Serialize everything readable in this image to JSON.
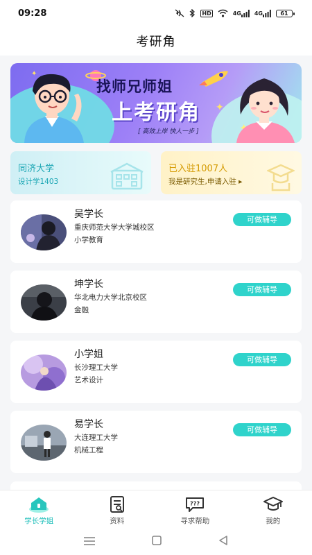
{
  "status_bar": {
    "time": "09:28",
    "net1": "4G",
    "net2": "4G",
    "hd": "HD",
    "battery": "61"
  },
  "header": {
    "title": "考研角"
  },
  "banner": {
    "title_line1": "找师兄师姐",
    "title_line2": "上考研角",
    "slogan": "[ 高效上岸 快人一步 ]"
  },
  "info_cards": {
    "left": {
      "title": "同济大学",
      "subtitle": "设计学1403"
    },
    "right": {
      "title": "已入驻1007人",
      "subtitle": "我是研究生,申请入驻 ▸"
    }
  },
  "mentors": [
    {
      "name": "吴学长",
      "school": "重庆师范大学大学城校区",
      "major": "小学教育",
      "button": "可做辅导"
    },
    {
      "name": "坤学长",
      "school": "华北电力大学北京校区",
      "major": "金融",
      "button": "可做辅导"
    },
    {
      "name": "小学姐",
      "school": "长沙理工大学",
      "major": "艺术设计",
      "button": "可做辅导"
    },
    {
      "name": "易学长",
      "school": "大连理工大学",
      "major": "机械工程",
      "button": "可做辅导"
    }
  ],
  "bottom_nav": [
    {
      "label": "学长学姐",
      "icon": "home-icon",
      "active": true
    },
    {
      "label": "资料",
      "icon": "document-icon",
      "active": false
    },
    {
      "label": "寻求帮助",
      "icon": "chat-bubble-icon",
      "active": false
    },
    {
      "label": "我的",
      "icon": "graduation-cap-icon",
      "active": false
    }
  ],
  "colors": {
    "accent": "#1fbfba",
    "button": "#2fd3cb",
    "banner_purple": "#8a73f3",
    "info_yellow": "#d49a00"
  }
}
